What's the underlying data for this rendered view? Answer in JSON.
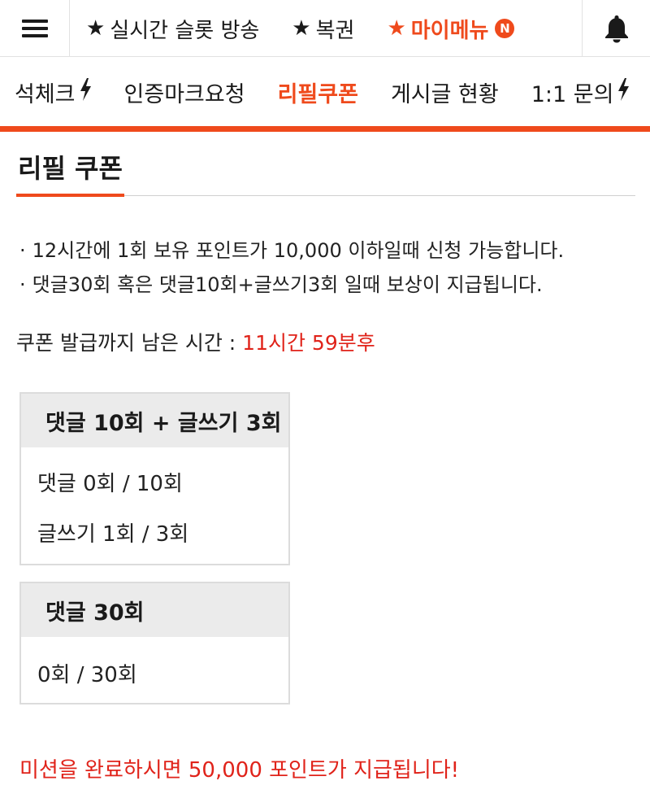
{
  "topbar": {
    "items": [
      {
        "label": "실시간 슬롯 방송",
        "star": "★",
        "active": false
      },
      {
        "label": "복권",
        "star": "★",
        "active": false
      },
      {
        "label": "마이메뉴",
        "star": "★",
        "active": true,
        "badge": "N"
      }
    ]
  },
  "subnav": {
    "items": [
      {
        "label": "석체크",
        "icon": "lightning-icon"
      },
      {
        "label": "인증마크요청"
      },
      {
        "label": "리필쿠폰",
        "active": true
      },
      {
        "label": "게시글 현황"
      },
      {
        "label": "1:1 문의",
        "icon": "lightning-icon"
      }
    ]
  },
  "page": {
    "title": "리필 쿠폰",
    "notices": [
      "12시간에 1회 보유 포인트가 10,000 이하일때 신청 가능합니다.",
      "댓글30회 혹은 댓글10회+글쓰기3회 일때 보상이 지급됩니다."
    ],
    "remaining_label": "쿠폰 발급까지 남은 시간 :",
    "remaining_time": "11시간 59분후"
  },
  "missions": [
    {
      "title": "댓글 10회 + 글쓰기 3회",
      "rows": [
        "댓글 0회 / 10회",
        "글쓰기 1회 / 3회"
      ]
    },
    {
      "title": "댓글 30회",
      "rows": [
        "0회 / 30회"
      ]
    }
  ],
  "footer_notice": "미션을 완료하시면 50,000 포인트가 지급됩니다!",
  "colors": {
    "accent": "#ef4a1c",
    "alert": "#e0231a",
    "box_header": "#ebebeb"
  }
}
